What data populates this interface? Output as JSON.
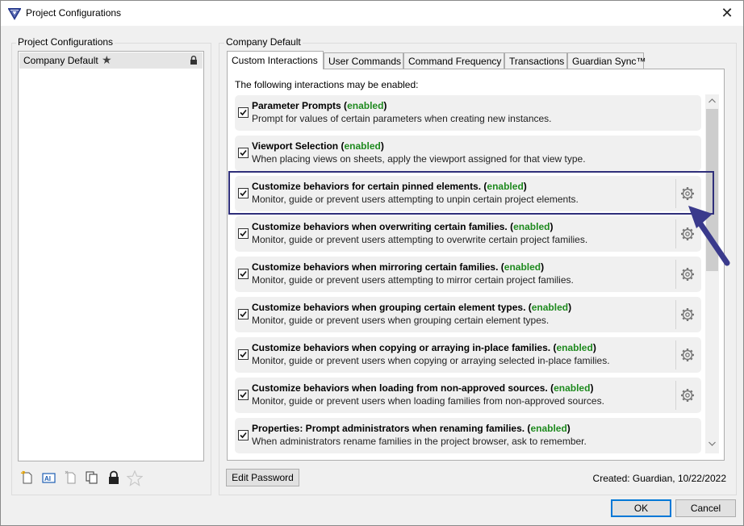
{
  "window": {
    "title": "Project Configurations",
    "close_symbol": "✕"
  },
  "left": {
    "group_label": "Project Configurations",
    "items": [
      {
        "label": "Company Default",
        "star": "★"
      }
    ],
    "toolbar_icons": [
      "new-config-icon",
      "rename-icon",
      "copy-icon",
      "duplicate-icon",
      "lock-icon",
      "star-icon"
    ]
  },
  "right": {
    "group_label": "Company Default",
    "tabs": [
      "Custom Interactions",
      "User Commands",
      "Command Frequency",
      "Transactions",
      "Guardian Sync™"
    ],
    "intro": "The following interactions may be enabled:",
    "status_word": "enabled",
    "rows": [
      {
        "title": "Parameter Prompts",
        "desc": "Prompt for values of certain parameters when creating new instances.",
        "gear": false
      },
      {
        "title": "Viewport Selection",
        "desc": "When placing views on sheets, apply the viewport assigned for that view type.",
        "gear": false
      },
      {
        "title": "Customize behaviors for certain pinned elements.",
        "desc": "Monitor, guide or prevent users attempting to unpin certain project elements.",
        "gear": true
      },
      {
        "title": "Customize behaviors when overwriting certain families.",
        "desc": "Monitor, guide or prevent users attempting to overwrite certain project families.",
        "gear": true
      },
      {
        "title": "Customize behaviors when mirroring certain families.",
        "desc": "Monitor, guide or prevent users attempting to mirror certain project families.",
        "gear": true
      },
      {
        "title": "Customize behaviors when grouping certain element types.",
        "desc": "Monitor, guide or prevent users when grouping certain element types.",
        "gear": true
      },
      {
        "title": "Customize behaviors when copying or arraying in-place families.",
        "desc": "Monitor, guide or prevent users when copying or arraying selected in-place families.",
        "gear": true
      },
      {
        "title": "Customize behaviors when loading from non-approved sources.",
        "desc": "Monitor, guide or prevent users when loading families from non-approved sources.",
        "gear": true
      },
      {
        "title": "Properties: Prompt administrators when renaming families.",
        "desc": "When administrators rename families in the project browser, ask to remember.",
        "gear": false
      }
    ]
  },
  "footer": {
    "edit_password": "Edit Password",
    "created": "Created: Guardian, 10/22/2022",
    "ok": "OK",
    "cancel": "Cancel"
  },
  "colors": {
    "enabled": "#1e8a1e",
    "highlight": "#2f2f7a",
    "arrow": "#3a3a8c"
  }
}
